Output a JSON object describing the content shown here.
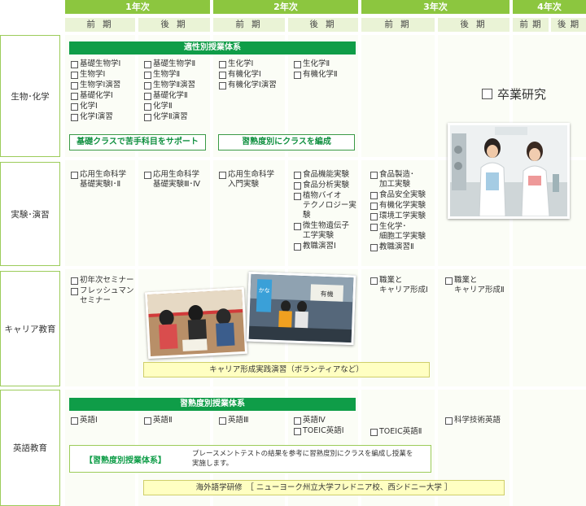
{
  "years": [
    "1年次",
    "2年次",
    "3年次",
    "4年次"
  ],
  "semesters": [
    "前 期",
    "後 期",
    "前 期",
    "後 期",
    "前 期",
    "後 期",
    "前 期",
    "後 期"
  ],
  "rows": {
    "bio": "生物･化学",
    "lab": "実験･演習",
    "career": "キャリア教育",
    "english": "英語教育"
  },
  "bio": {
    "bar": "適性別授業体系",
    "y1_first": [
      "基礎生物学Ⅰ",
      "生物学Ⅰ",
      "生物学Ⅰ演習",
      "基礎化学Ⅰ",
      "化学Ⅰ",
      "化学Ⅰ演習"
    ],
    "y1_second": [
      "基礎生物学Ⅱ",
      "生物学Ⅱ",
      "生物学Ⅱ演習",
      "基礎化学Ⅱ",
      "化学Ⅱ",
      "化学Ⅱ演習"
    ],
    "y2_first": [
      "生化学Ⅰ",
      "有機化学Ⅰ",
      "有機化学Ⅰ演習"
    ],
    "y2_second": [
      "生化学Ⅱ",
      "有機化学Ⅱ"
    ],
    "support": "基礎クラスで苦手科目をサポート",
    "class": "習熟度別にクラスを編成",
    "graduation": "卒業研究"
  },
  "lab": {
    "y1_first": "応用生命科学\n基礎実験Ⅰ･Ⅱ",
    "y1_second": "応用生命科学\n基礎実験Ⅲ･Ⅳ",
    "y2_first": "応用生命科学\n入門実験",
    "y2_second": [
      "食品機能実験",
      "食品分析実験",
      "植物バイオ\nテクノロジー実験",
      "微生物遺伝子\n工学実験",
      "教職演習Ⅰ"
    ],
    "y3_first": [
      "食品製造･\n加工実験",
      "食品安全実験",
      "有機化学実験",
      "環境工学実験",
      "生化学･\n細胞工学実験",
      "教職演習Ⅱ"
    ]
  },
  "career": {
    "y1_first": [
      "初年次セミナー",
      "フレッシュマン\nセミナー"
    ],
    "y3_first": "職業と\nキャリア形成Ⅰ",
    "y3_second": "職業と\nキャリア形成Ⅱ",
    "bar": "キャリア形成実践演習（ボランティアなど）",
    "sign1": "かな",
    "sign2": "有機"
  },
  "english": {
    "bar": "習熟度別授業体系",
    "y1_first": "英語Ⅰ",
    "y1_second": "英語Ⅱ",
    "y2_first": "英語Ⅲ",
    "y2_second": [
      "英語Ⅳ",
      "TOEIC英語Ⅰ"
    ],
    "y3_first": "TOEIC英語Ⅱ",
    "y3_second": "科学技術英語",
    "note_title": "【習熟度別授業体系】",
    "note_text": "プレースメントテストの結果を参考に習熟度別にクラスを編成し授業を\n実施します。",
    "abroad": "海外語学研修　［ ニューヨーク州立大学フレドニア校、西シドニー大学 ］"
  },
  "colors": {
    "green": "#8cc63f",
    "dark_green": "#0f9d48",
    "light": "#f4f9ea",
    "yellow": "#ffffc2"
  }
}
